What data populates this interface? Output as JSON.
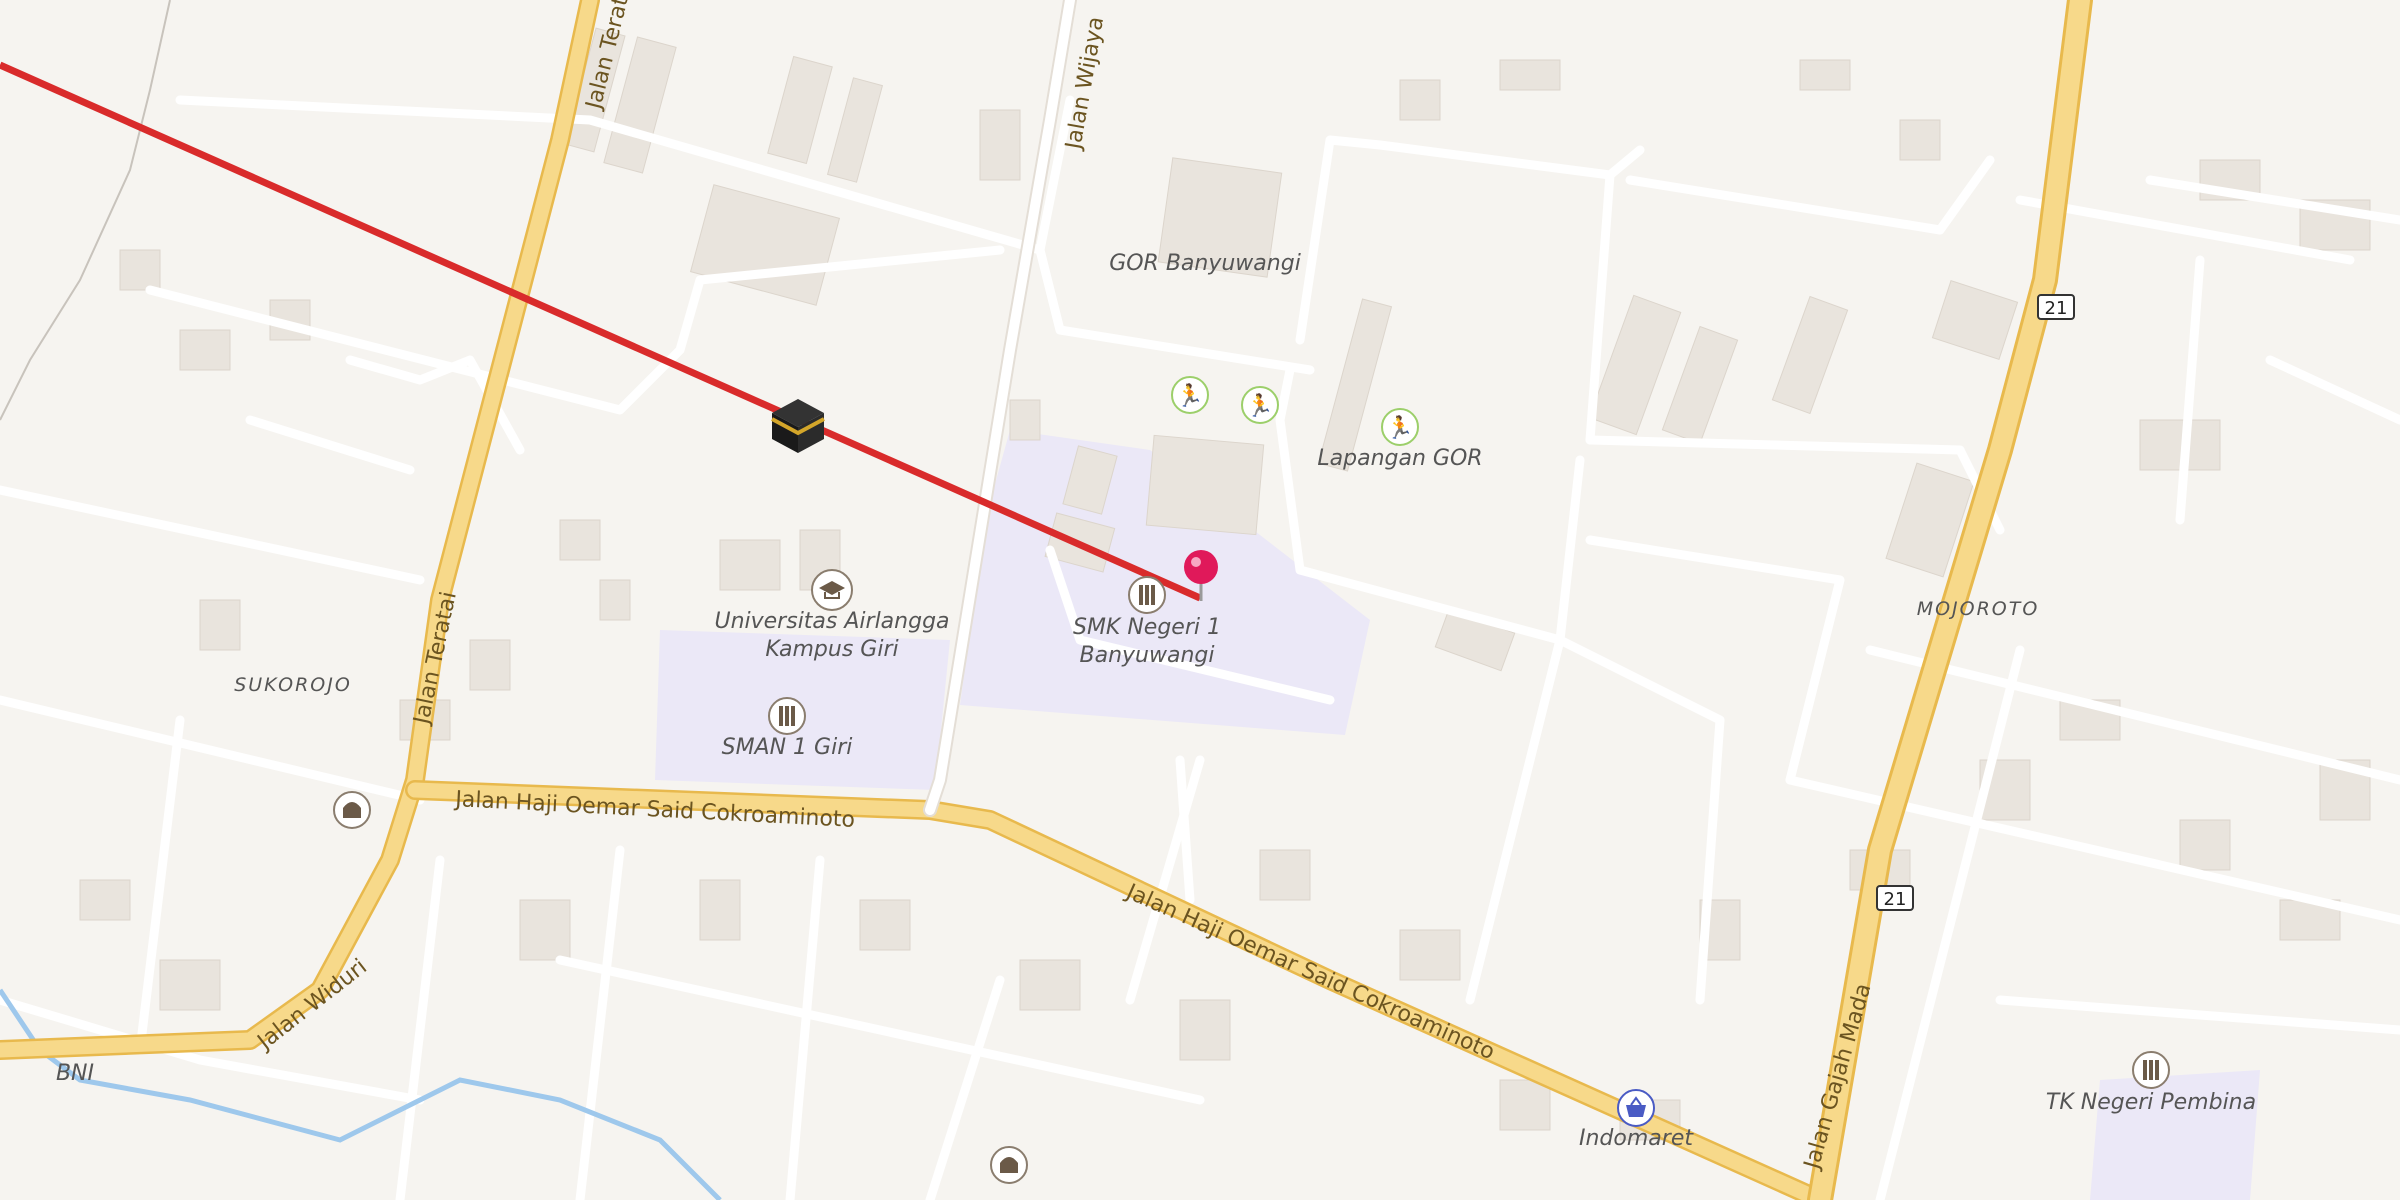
{
  "map": {
    "road_labels": {
      "teratai_north": "Jalan Teratai",
      "teratai_south": "Jalan Teratai",
      "wijaya": "Jalan Wijaya",
      "cokro_west": "Jalan Haji Oemar Said Cokroaminoto",
      "cokro_east": "Jalan Haji Oemar Said Cokroaminoto",
      "widuri": "Jalan Widuri",
      "gajah_mada": "Jalan Gajah Mada"
    },
    "route_shields": [
      "21",
      "21"
    ],
    "place_labels": {
      "gor": "GOR Banyuwangi",
      "lapangan": "Lapangan GOR",
      "unair_line1": "Universitas Airlangga",
      "unair_line2": "Kampus Giri",
      "smk_line1": "SMK Negeri 1",
      "smk_line2": "Banyuwangi",
      "sman": "SMAN 1 Giri",
      "indomaret": "Indomaret",
      "tk": "TK Negeri Pembina",
      "bni": "BNI"
    },
    "district_labels": {
      "sukorojo": "SUKOROJO",
      "mojoroto": "MOJOROTO"
    },
    "icons": [
      "kaaba-icon",
      "location-pin-icon",
      "school-icon",
      "graduation-cap-icon",
      "sports-icon",
      "shopping-basket-icon",
      "mosque-icon"
    ],
    "colors": {
      "background": "#f6f4f0",
      "building": "#e9e4dd",
      "main_road": "#f7d98a",
      "minor_road": "#ffffff",
      "qibla_line": "#d92b2b",
      "pin": "#e0195a",
      "campus_area": "#ebe8f7",
      "water": "#9ec8ec"
    }
  }
}
